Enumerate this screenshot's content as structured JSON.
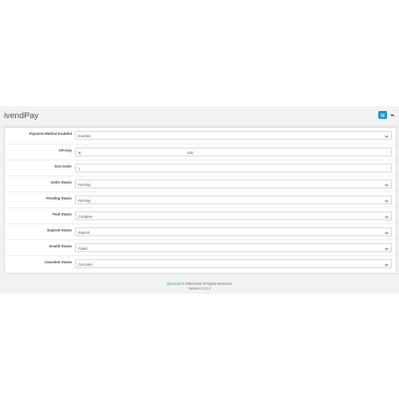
{
  "header": {
    "title": "ivendPay"
  },
  "fields": [
    {
      "label": "Payment Method Enabled",
      "type": "select",
      "value": "Enabled"
    },
    {
      "label": "API Key",
      "type": "text",
      "value": "9(",
      "value_tail": "b92"
    },
    {
      "label": "Sort Order",
      "type": "text",
      "value": "1"
    },
    {
      "label": "Order Status",
      "type": "select",
      "value": "Pending"
    },
    {
      "label": "Pending Status",
      "type": "select",
      "value": "Pending"
    },
    {
      "label": "Paid Status",
      "type": "select",
      "value": "Complete"
    },
    {
      "label": "Expired Status",
      "type": "select",
      "value": "Expired"
    },
    {
      "label": "Invalid Status",
      "type": "select",
      "value": "Failed"
    },
    {
      "label": "Canceled Status",
      "type": "select",
      "value": "Canceled"
    }
  ],
  "footer": {
    "link": "OpenCart",
    "copyright": " © 2009-2023 All Rights Reserved.",
    "version": "Version 4.0.2.2"
  },
  "colors": {
    "accent": "#1e91cf",
    "header_bg": "#f2f2f2"
  },
  "icons": {
    "save": "save-icon",
    "back": "reply-icon",
    "select": "chevron-down-icon"
  }
}
